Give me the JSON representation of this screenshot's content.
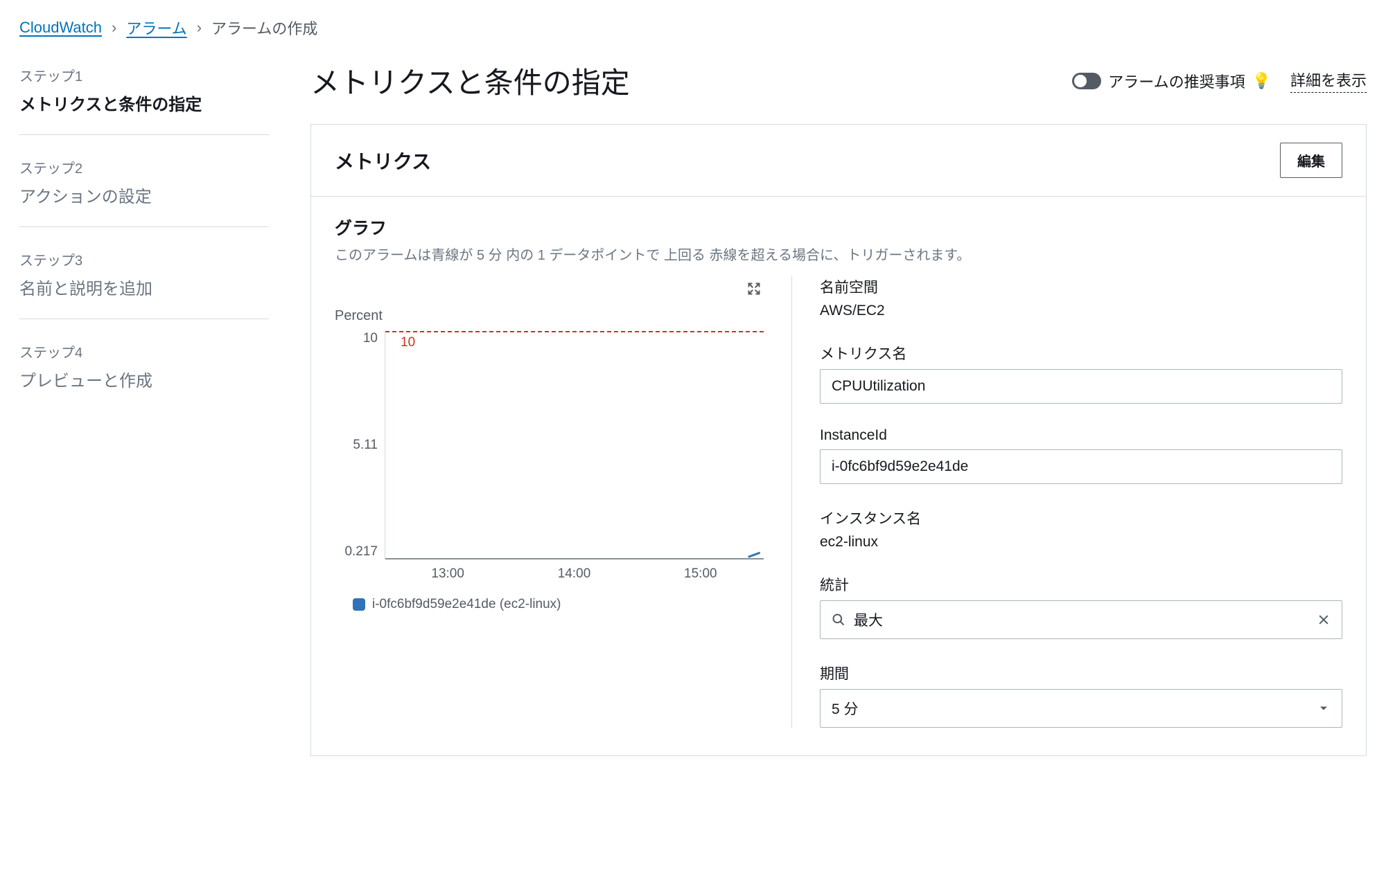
{
  "breadcrumb": {
    "root": "CloudWatch",
    "level1": "アラーム",
    "current": "アラームの作成"
  },
  "steps": [
    {
      "num": "ステップ1",
      "title": "メトリクスと条件の指定",
      "current": true
    },
    {
      "num": "ステップ2",
      "title": "アクションの設定",
      "current": false
    },
    {
      "num": "ステップ3",
      "title": "名前と説明を追加",
      "current": false
    },
    {
      "num": "ステップ4",
      "title": "プレビューと作成",
      "current": false
    }
  ],
  "header": {
    "title": "メトリクスと条件の指定",
    "toggle_label": "アラームの推奨事項",
    "details_link": "詳細を表示"
  },
  "panel": {
    "title": "メトリクス",
    "edit_btn": "編集",
    "graph_label": "グラフ",
    "graph_desc": "このアラームは青線が 5 分 内の 1 データポイントで 上回る 赤線を超える場合に、トリガーされます。"
  },
  "chart_data": {
    "type": "line",
    "title": "",
    "ylabel": "Percent",
    "xlabel": "",
    "ylim": [
      0.217,
      10
    ],
    "y_ticks": [
      "10",
      "5.11",
      "0.217"
    ],
    "x_ticks": [
      "13:00",
      "14:00",
      "15:00"
    ],
    "threshold": {
      "value": 10,
      "label": "10",
      "color": "#d13212"
    },
    "series": [
      {
        "name": "i-0fc6bf9d59e2e41de (ec2-linux)",
        "color": "#2e73b8",
        "x": [
          "13:00",
          "14:00",
          "15:00"
        ],
        "values": [
          0.217,
          0.217,
          0.3
        ]
      }
    ]
  },
  "details": {
    "namespace_label": "名前空間",
    "namespace_value": "AWS/EC2",
    "metric_name_label": "メトリクス名",
    "metric_name_value": "CPUUtilization",
    "instance_id_label": "InstanceId",
    "instance_id_value": "i-0fc6bf9d59e2e41de",
    "instance_name_label": "インスタンス名",
    "instance_name_value": "ec2-linux",
    "statistic_label": "統計",
    "statistic_value": "最大",
    "period_label": "期間",
    "period_value": "5 分"
  }
}
